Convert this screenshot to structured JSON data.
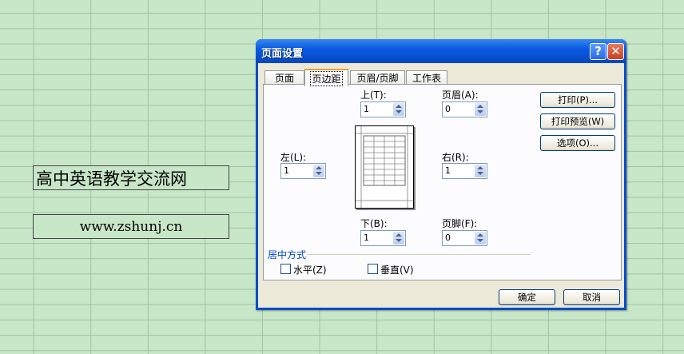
{
  "textboxes": {
    "title": "高中英语教学交流网",
    "url": "www.zshunj.cn"
  },
  "dialog": {
    "title": "页面设置",
    "help_label": "?",
    "close_label": "✕",
    "tabs": [
      "页面",
      "页边距",
      "页眉/页脚",
      "工作表"
    ],
    "active_tab": "页边距",
    "margins": {
      "top_label": "上(T):",
      "top_value": "1",
      "header_label": "页眉(A):",
      "header_value": "0",
      "left_label": "左(L):",
      "left_value": "1",
      "right_label": "右(R):",
      "right_value": "1",
      "bottom_label": "下(B):",
      "bottom_value": "1",
      "footer_label": "页脚(F):",
      "footer_value": "0"
    },
    "side_buttons": {
      "print": "打印(P)...",
      "preview": "打印预览(W)",
      "options": "选项(O)..."
    },
    "center": {
      "group_label": "居中方式",
      "horizontal_label": "水平(Z)",
      "vertical_label": "垂直(V)",
      "horizontal_checked": false,
      "vertical_checked": false
    },
    "ok_label": "确定",
    "cancel_label": "取消"
  },
  "colors": {
    "sheet_background": "#c8e6c8",
    "title_bar": "#0a5ae0",
    "dialog_face": "#ece9d8"
  }
}
